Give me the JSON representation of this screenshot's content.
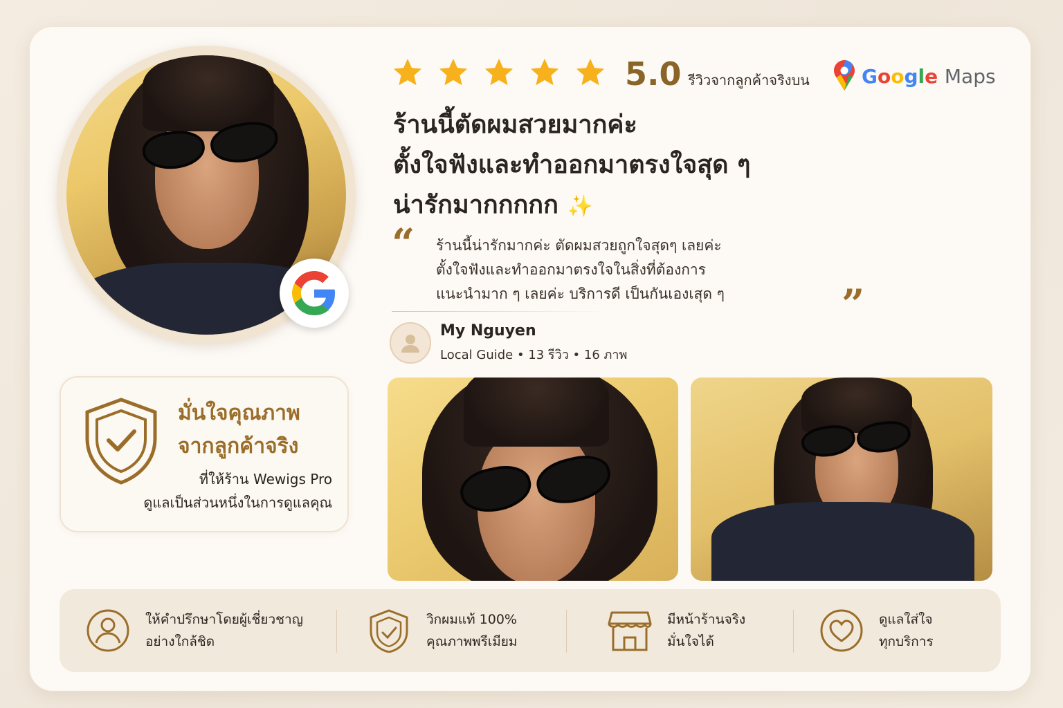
{
  "rating": {
    "stars": 5,
    "score": "5.0",
    "caption": "รีวิวจากลูกค้าจริงบน",
    "platform": "Google Maps",
    "platform_parts": {
      "google": "Google",
      "maps": "Maps"
    },
    "star_color": "#f6b11c"
  },
  "headline": {
    "line1": "ร้านนี้ตัดผมสวยมากค่ะ",
    "line2": "ตั้งใจฟังและทำออกมาตรงใจสุด ๆ",
    "line3": "น่ารักมากกกกก",
    "sparkle": "✨"
  },
  "quote": {
    "open": "“",
    "close": "”",
    "line1": "ร้านนี้น่ารักมากค่ะ ตัดผมสวยถูกใจสุดๆ เลยค่ะ",
    "line2": "ตั้งใจฟังและทำออกมาตรงใจในสิ่งที่ต้องการ",
    "line3": "แนะนำมาก ๆ เลยค่ะ บริการดี เป็นกันเองเสุด ๆ"
  },
  "reviewer": {
    "name": "My Nguyen",
    "meta": "Local Guide • 13 รีวิว • 16 ภาพ"
  },
  "quality": {
    "title_line1": "มั่นใจคุณภาพ",
    "title_line2": "จากลูกค้าจริง",
    "sub_line1": "ที่ให้ร้าน Wewigs Pro",
    "sub_line2": "ดูแลเป็นส่วนหนึ่งในการดูแลคุณ"
  },
  "features": [
    {
      "icon": "person-icon",
      "line1": "ให้คำปรึกษาโดยผู้เชี่ยวชาญ",
      "line2": "อย่างใกล้ชิด"
    },
    {
      "icon": "shield-check-icon",
      "line1": "วิกผมแท้ 100%",
      "line2": "คุณภาพพรีเมียม"
    },
    {
      "icon": "store-icon",
      "line1": "มีหน้าร้านจริง",
      "line2": "มั่นใจได้"
    },
    {
      "icon": "heart-icon",
      "line1": "ดูแลใส่ใจ",
      "line2": "ทุกบริการ"
    }
  ],
  "colors": {
    "accent_gold": "#9a6e2a",
    "background": "#fdfaf6"
  }
}
